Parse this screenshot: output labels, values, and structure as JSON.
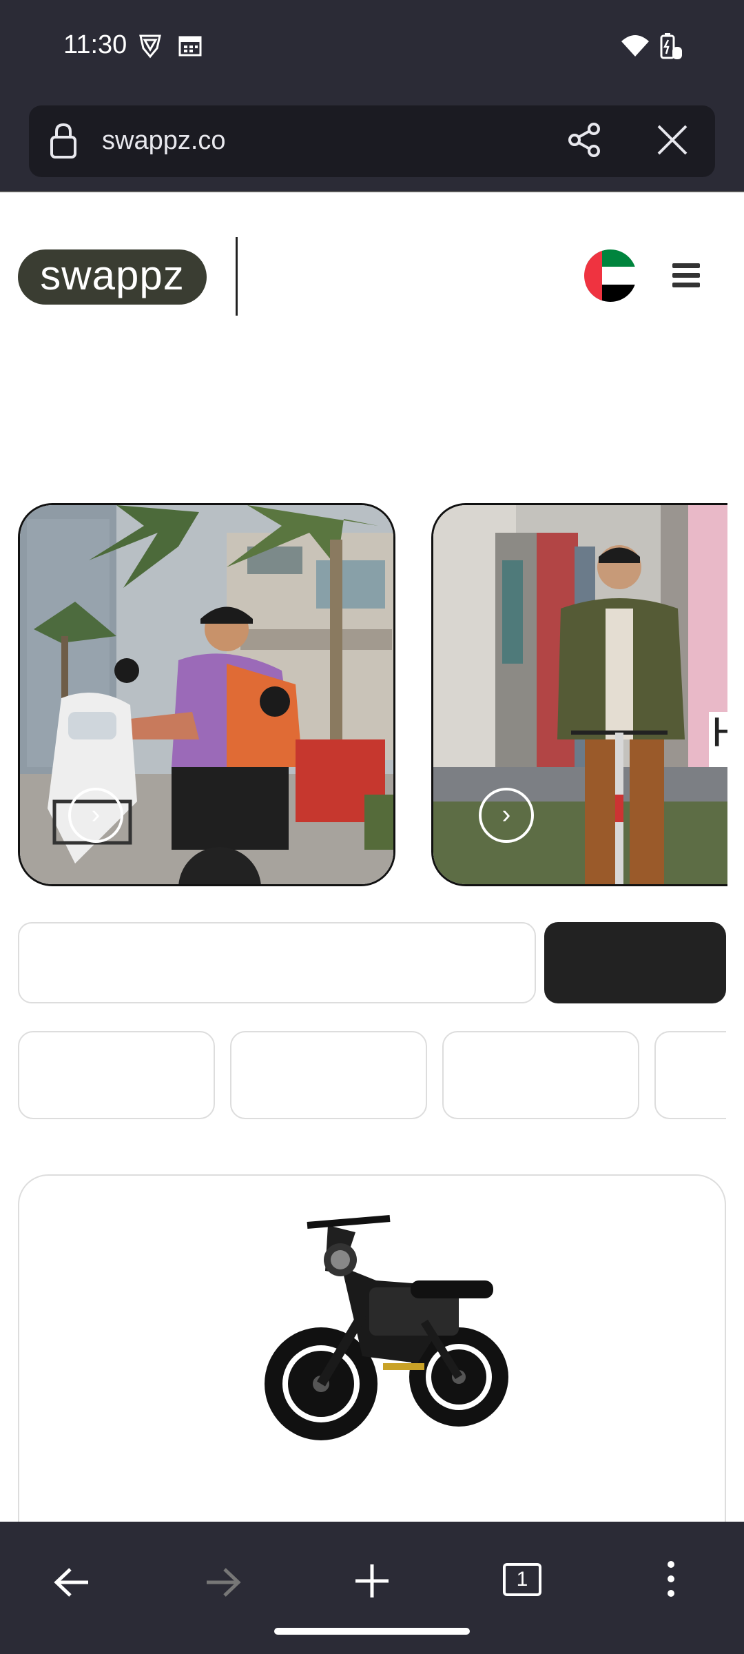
{
  "status_bar": {
    "time": "11:30",
    "icons": [
      "vpn-shield-icon",
      "calendar-icon",
      "wifi-icon",
      "battery-icon"
    ]
  },
  "browser": {
    "url": "swappz.co",
    "icons": [
      "lock-icon",
      "share-icon",
      "close-icon"
    ]
  },
  "site": {
    "logo_text": "swappz",
    "flag": "uae-flag",
    "menu_icon": "hamburger-menu-icon"
  },
  "carousel": {
    "cards": [
      {
        "name": "delivery-rider-moped"
      },
      {
        "name": "man-on-scooter"
      }
    ],
    "play_icon": "›"
  },
  "search": {
    "input_value": "",
    "button_label": ""
  },
  "chips": [
    "",
    "",
    "",
    ""
  ],
  "product": {
    "image": "electric-fat-tire-bike"
  },
  "bottom_nav": {
    "icons": [
      "back-icon",
      "forward-icon",
      "new-tab-icon",
      "tab-count-icon",
      "more-icon"
    ],
    "tab_count": "1"
  },
  "colors": {
    "system_bar": "#2b2b36",
    "url_box": "#1b1b22",
    "logo_pill": "#3a3d32",
    "search_button": "#222222",
    "border": "#dddddd"
  }
}
